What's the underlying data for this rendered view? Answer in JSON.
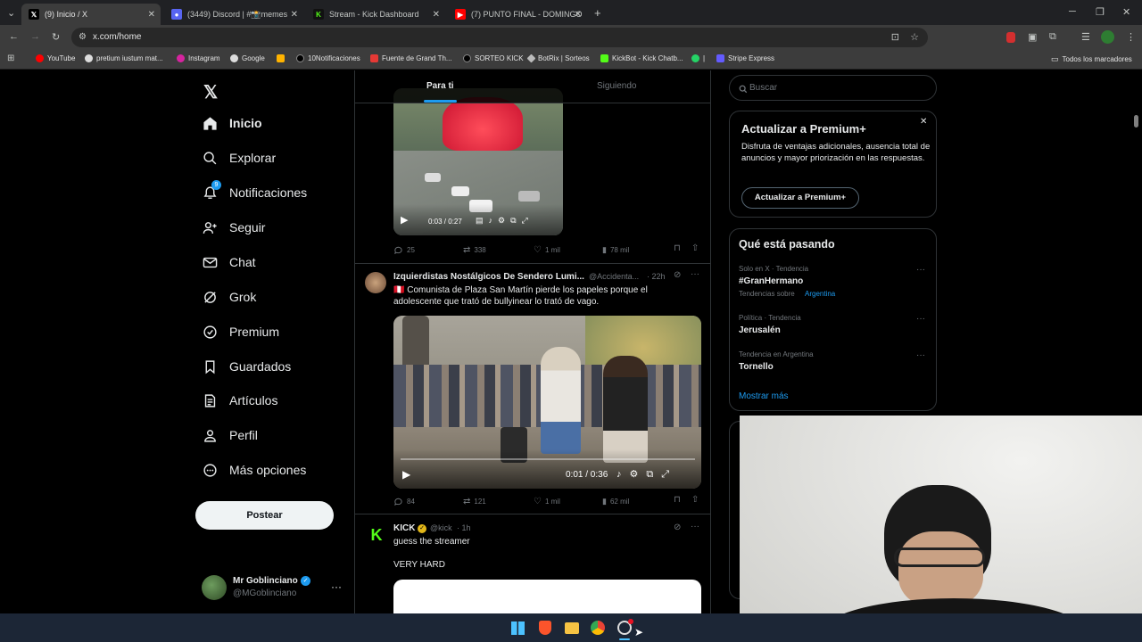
{
  "browser": {
    "tabs": [
      {
        "title": "(9) Inicio / X"
      },
      {
        "title": "(3449) Discord | #📸memes"
      },
      {
        "title": "Stream - Kick Dashboard"
      },
      {
        "title": "(7) PUNTO FINAL - DOMINGO"
      }
    ],
    "url": "x.com/home",
    "bookmarks": [
      "YouTube",
      "pretium iustum mat...",
      "Instagram",
      "Google",
      "10Notificaciones",
      "Fuente de Grand Th...",
      "SORTEO KICK",
      "BotRix | Sorteos",
      "KickBot - Kick Chatb...",
      "|",
      "Stripe Express"
    ],
    "all_bookmarks": "Todos los marcadores"
  },
  "nav": {
    "items": [
      "Inicio",
      "Explorar",
      "Notificaciones",
      "Seguir",
      "Chat",
      "Grok",
      "Premium",
      "Guardados",
      "Artículos",
      "Perfil",
      "Más opciones"
    ],
    "notif_badge": "9",
    "post_label": "Postear"
  },
  "account": {
    "name": "Mr Goblinciano",
    "handle": "@MGoblinciano"
  },
  "feed": {
    "tabs": [
      "Para ti",
      "Siguiendo"
    ],
    "posts": [
      {
        "time": "0:03 / 0:27",
        "replies": "25",
        "reposts": "338",
        "likes": "1 mil",
        "views": "78 mil"
      },
      {
        "name": "Izquierdistas Nostálgicos De Sendero Lumi...",
        "handle": "@Accidenta...",
        "age": "· 22h",
        "text": "🇵🇪 Comunista de Plaza San Martín pierde los papeles porque el adolescente que trató de bullyinear lo trató de vago.",
        "time": "0:01 / 0:36",
        "replies": "84",
        "reposts": "121",
        "likes": "1 mil",
        "views": "62 mil"
      },
      {
        "name": "KICK",
        "handle": "@kick",
        "age": "· 1h",
        "text": "guess the streamer",
        "text2": "VERY HARD"
      }
    ]
  },
  "sidebar": {
    "search_placeholder": "Buscar",
    "premium": {
      "title": "Actualizar a Premium+",
      "body": "Disfruta de ventajas adicionales, ausencia total de anuncios y mayor priorización en las respuestas.",
      "button": "Actualizar a Premium+"
    },
    "trends_title": "Qué está pasando",
    "trends": [
      {
        "meta": "Solo en X · Tendencia",
        "name": "#GranHermano",
        "sub": "Tendencias sobre",
        "sub_link": "Argentina"
      },
      {
        "meta": "Política · Tendencia",
        "name": "Jerusalén"
      },
      {
        "meta": "Tendencia en Argentina",
        "name": "Tornello"
      }
    ],
    "show_more": "Mostrar más"
  },
  "colors": {
    "accent": "#1d9bf0",
    "kick": "#53fc18",
    "bg": "#000000"
  }
}
